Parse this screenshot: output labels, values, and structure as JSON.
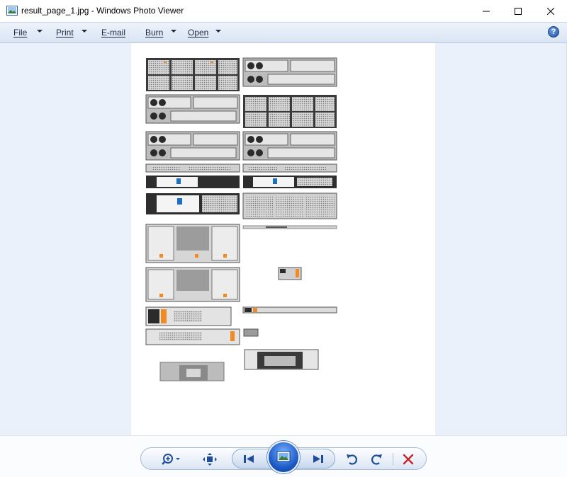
{
  "window": {
    "title": "result_page_1.jpg - Windows Photo Viewer"
  },
  "menu": {
    "items": [
      {
        "label": "File",
        "has_dropdown": true
      },
      {
        "label": "Print",
        "has_dropdown": true
      },
      {
        "label": "E-mail",
        "has_dropdown": false
      },
      {
        "label": "Burn",
        "has_dropdown": true
      },
      {
        "label": "Open",
        "has_dropdown": true
      }
    ],
    "help_label": "?"
  },
  "toolbar": {
    "buttons": [
      "zoom-icon",
      "actual-size-icon",
      "previous-icon",
      "slideshow-icon",
      "next-icon",
      "rotate-ccw-icon",
      "rotate-cw-icon",
      "delete-icon"
    ]
  },
  "colors": {
    "viewer_background": "#eaf1fb",
    "menu_gradient_top": "#eef3fb",
    "accent_blue": "#1e5cc8",
    "delete_red": "#c8242b",
    "server_orange": "#f08a24",
    "netapp_blue": "#1c6fc6"
  }
}
